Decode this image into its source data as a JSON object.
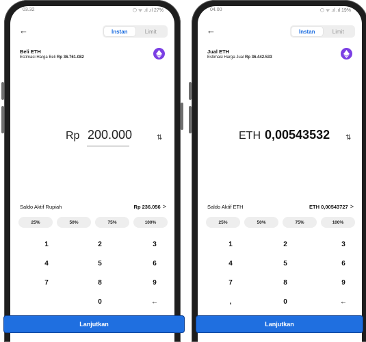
{
  "colors": {
    "accent": "#1f6fe0",
    "coin": "#7b3fe4"
  },
  "buy": {
    "status_time": "03.32",
    "status_right": "⬡ ᯤ .ıl .ıl 27%",
    "tab_active": "Instan",
    "tab_inactive": "Limit",
    "title": "Beli ETH",
    "estimate_label": "Estimasi Harga Beli",
    "estimate_value": "Rp 36.761.082",
    "amount_prefix": "Rp",
    "amount_value": "200.000",
    "balance_label": "Saldo Aktif Rupiah",
    "balance_value": "Rp 236.056",
    "percents": [
      "25%",
      "50%",
      "75%",
      "100%"
    ],
    "keys": [
      "1",
      "2",
      "3",
      "4",
      "5",
      "6",
      "7",
      "8",
      "9",
      "",
      "0",
      "←"
    ]
  },
  "sell": {
    "status_time": "04.00",
    "status_right": "⬡ ᯤ .ıl .ıl 19%",
    "tab_active": "Instan",
    "tab_inactive": "Limit",
    "title": "Jual ETH",
    "estimate_label": "Estimasi Harga Jual",
    "estimate_value": "Rp 36.442.533",
    "amount_prefix": "ETH",
    "amount_value": "0,00543532",
    "balance_label": "Saldo Aktif ETH",
    "balance_value": "ETH 0,00543727",
    "percents": [
      "25%",
      "50%",
      "75%",
      "100%"
    ],
    "keys": [
      "1",
      "2",
      "3",
      "4",
      "5",
      "6",
      "7",
      "8",
      "9",
      ",",
      "0",
      "←"
    ]
  },
  "continue_label": "Lanjutkan"
}
